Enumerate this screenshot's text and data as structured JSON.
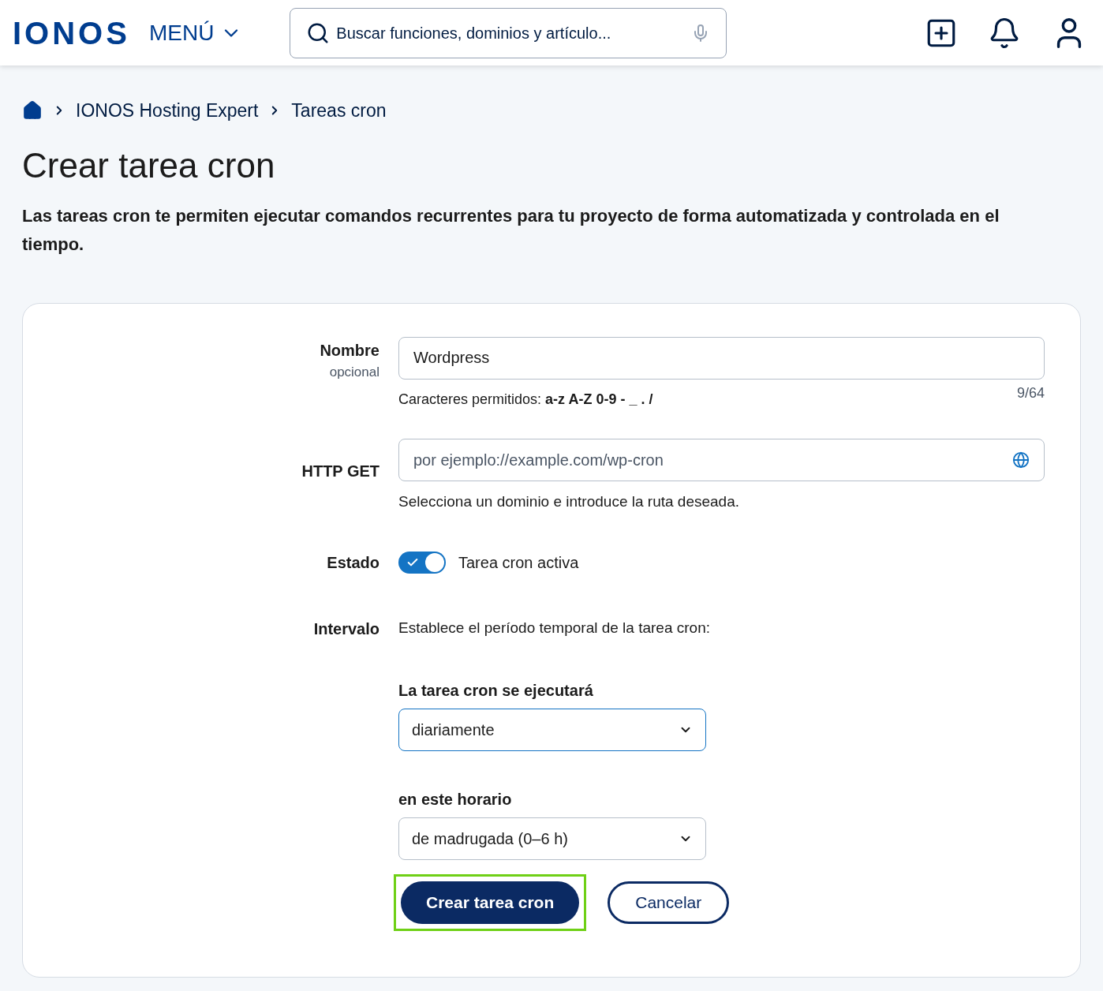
{
  "header": {
    "logo": "IONOS",
    "menu_label": "MENÚ",
    "search": {
      "placeholder": "Buscar funciones, dominios y artículo..."
    }
  },
  "breadcrumb": [
    "IONOS Hosting Expert",
    "Tareas cron"
  ],
  "page": {
    "title": "Crear tarea cron",
    "description": "Las tareas cron te permiten ejecutar comandos recurrentes para tu proyecto de forma automatizada y controlada en el tiempo."
  },
  "form": {
    "name": {
      "label": "Nombre",
      "sublabel": "opcional",
      "value": "Wordpress",
      "hint": "Caracteres permitidos: **a-z A-Z 0-9 - _ . /**",
      "counter": "9/64"
    },
    "http_get": {
      "label": "HTTP GET",
      "placeholder": "por ejemplo://example.com/wp-cron",
      "hint": "Selecciona un dominio e introduce la ruta deseada."
    },
    "status": {
      "label": "Estado",
      "on": true,
      "text": "Tarea cron activa"
    },
    "interval": {
      "label": "Intervalo",
      "text": "Establece el período temporal de la tarea cron:"
    },
    "frequency": {
      "label": "La tarea cron se ejecutará",
      "value": "diariamente",
      "focused": true
    },
    "time_window": {
      "label": "en este horario",
      "value": "de madrugada (0–6 h)",
      "focused": false
    }
  },
  "buttons": [
    {
      "label": "Crear tarea cron",
      "kind": "primary",
      "highlighted": true
    },
    {
      "label": "Cancelar",
      "kind": "secondary",
      "highlighted": false
    }
  ]
}
